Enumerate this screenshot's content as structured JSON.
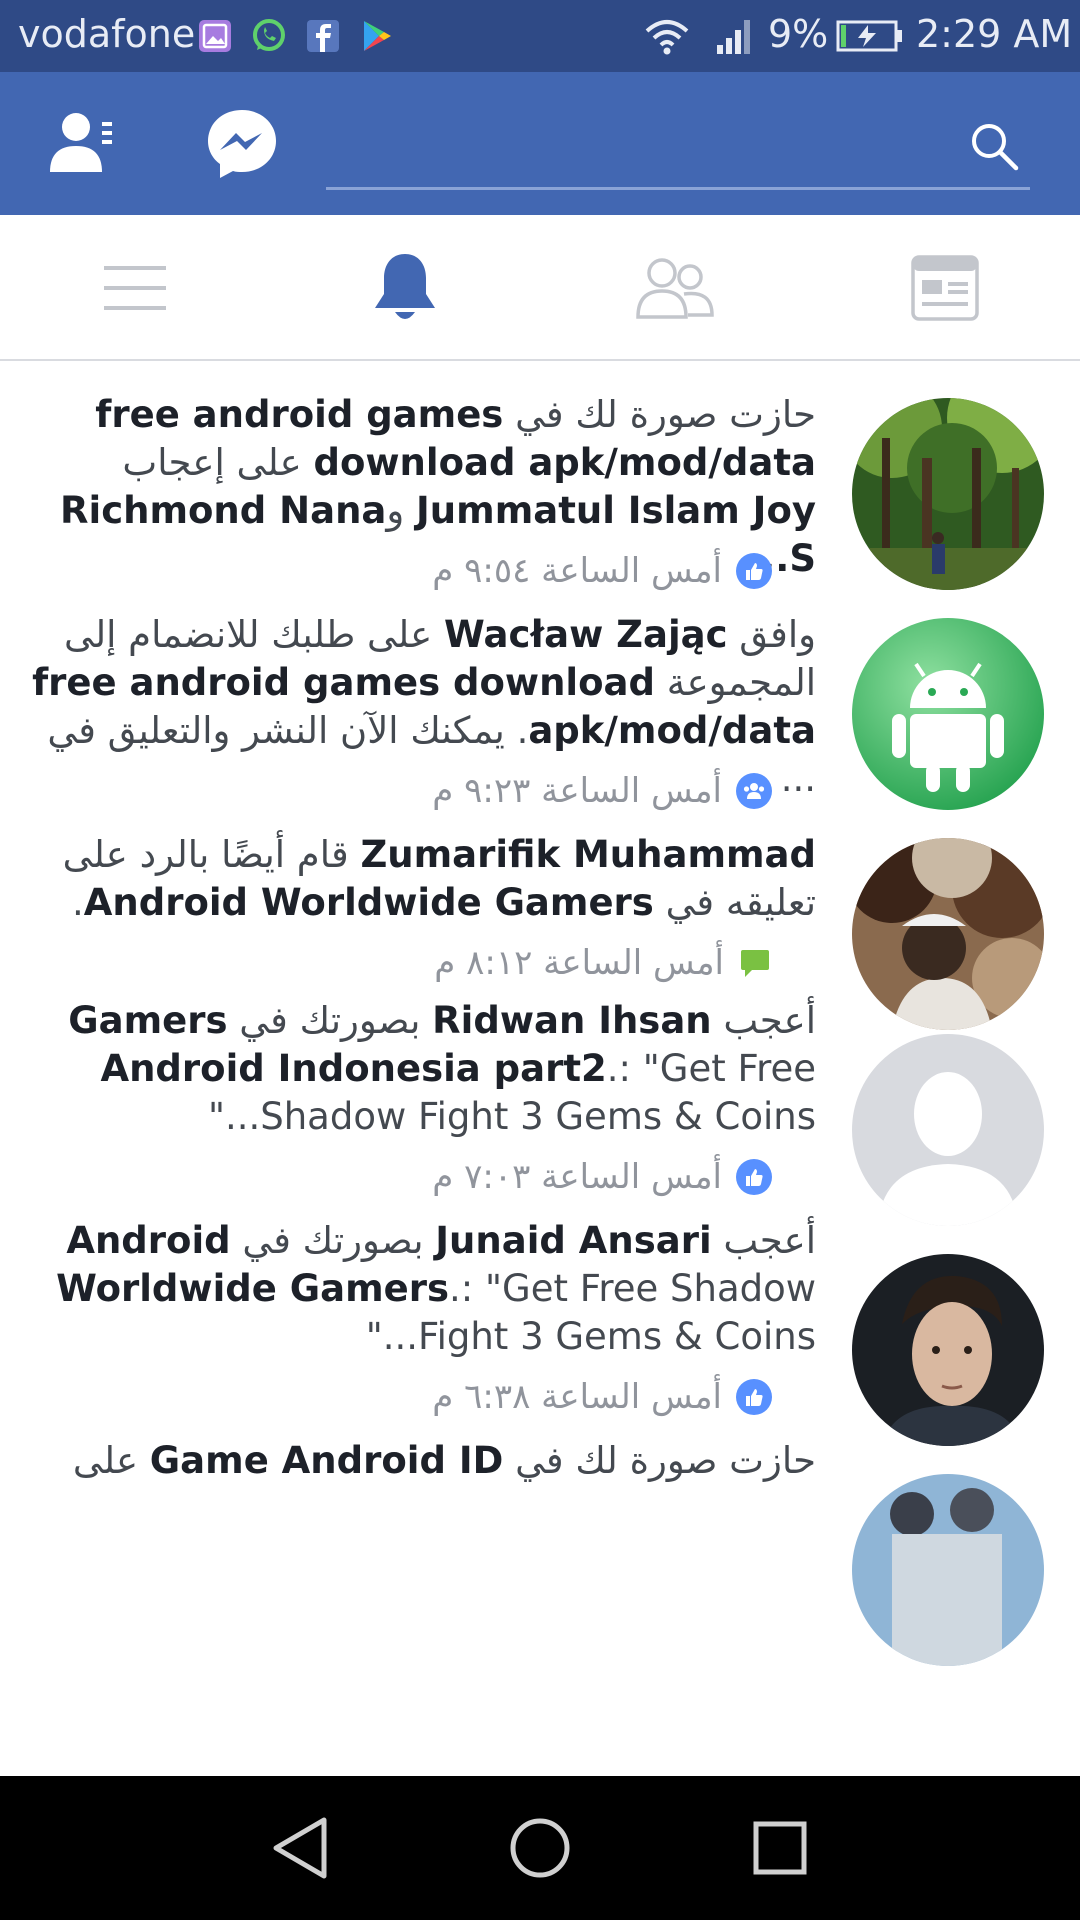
{
  "status": {
    "carrier": "vodafone",
    "battery": "9%",
    "time": "2:29 AM"
  },
  "header": {
    "search_placeholder": ""
  },
  "tabs": [
    {
      "name": "menu",
      "active": false
    },
    {
      "name": "notifications",
      "active": true
    },
    {
      "name": "friends",
      "active": false
    },
    {
      "name": "news-feed",
      "active": false
    }
  ],
  "notifications": [
    {
      "lines": [
        [
          {
            "t": "حازت صورة لك في ",
            "b": false
          },
          {
            "t": "free android games",
            "b": true
          }
        ],
        [
          {
            "t": "download apk/mod/data",
            "b": true
          },
          {
            "t": " على إعجاب",
            "b": false
          }
        ],
        [
          {
            "t": "Jummatul Islam Joy",
            "b": true
          },
          {
            "t": " و",
            "b": false
          },
          {
            "t": "Richmond Nana S...",
            "b": true
          }
        ]
      ],
      "time": "أمس الساعة ٩:٥٤ م",
      "badge": "like"
    },
    {
      "lines": [
        [
          {
            "t": "وافق ",
            "b": false
          },
          {
            "t": "Wacław Zając",
            "b": true
          },
          {
            "t": " على طلبك للانضمام إلى",
            "b": false
          }
        ],
        [
          {
            "t": "المجموعة ",
            "b": false
          },
          {
            "t": "free android games download",
            "b": true
          }
        ],
        [
          {
            "t": "apk/mod/data",
            "b": true
          },
          {
            "t": ". يمكنك الآن النشر والتعليق في ...",
            "b": false
          }
        ]
      ],
      "time": "أمس الساعة ٩:٢٣ م",
      "badge": "group"
    },
    {
      "lines": [
        [
          {
            "t": "Zumarifik Muhammad",
            "b": true
          },
          {
            "t": " قام أيضًا بالرد على",
            "b": false
          }
        ],
        [
          {
            "t": "تعليقه في ",
            "b": false
          },
          {
            "t": "Android Worldwide Gamers",
            "b": true
          },
          {
            "t": ".",
            "b": false
          }
        ]
      ],
      "time": "أمس الساعة ٨:١٢ م",
      "badge": "comment"
    },
    {
      "lines": [
        [
          {
            "t": "أعجب ",
            "b": false
          },
          {
            "t": "Ridwan Ihsan",
            "b": true
          },
          {
            "t": " بصورتك في ",
            "b": false
          },
          {
            "t": "Gamers",
            "b": true
          }
        ],
        [
          {
            "t": "Android Indonesia part2",
            "b": true
          },
          {
            "t": ".: \"Get Free",
            "b": false
          }
        ],
        [
          {
            "t": "Shadow Fight 3 Gems & Coins...\"",
            "b": false
          }
        ]
      ],
      "time": "أمس الساعة ٧:٠٣ م",
      "badge": "like"
    },
    {
      "lines": [
        [
          {
            "t": "أعجب ",
            "b": false
          },
          {
            "t": "Junaid Ansari",
            "b": true
          },
          {
            "t": " بصورتك في ",
            "b": false
          },
          {
            "t": "Android",
            "b": true
          }
        ],
        [
          {
            "t": "Worldwide Gamers",
            "b": true
          },
          {
            "t": ".: \"Get Free Shadow",
            "b": false
          }
        ],
        [
          {
            "t": "Fight 3 Gems & Coins...\"",
            "b": false
          }
        ]
      ],
      "time": "أمس الساعة ٦:٣٨ م",
      "badge": "like"
    },
    {
      "lines": [
        [
          {
            "t": "حازت صورة لك في ",
            "b": false
          },
          {
            "t": "Game Android ID",
            "b": true
          },
          {
            "t": " على",
            "b": false
          }
        ]
      ],
      "time": "",
      "badge": ""
    }
  ],
  "colors": {
    "status_bar": "#2f4a86",
    "header": "#4267b2",
    "active_tab": "#4267b2",
    "like_badge": "#5890ff",
    "comment_badge": "#7ac142"
  }
}
